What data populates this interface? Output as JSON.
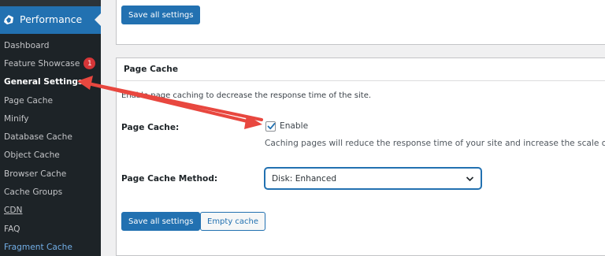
{
  "sidebar": {
    "menu_title": "Performance",
    "items": [
      {
        "label": "Dashboard",
        "badge": ""
      },
      {
        "label": "Feature Showcase",
        "badge": "1"
      },
      {
        "label": "General Settings",
        "badge": ""
      },
      {
        "label": "Page Cache",
        "badge": ""
      },
      {
        "label": "Minify",
        "badge": ""
      },
      {
        "label": "Database Cache",
        "badge": ""
      },
      {
        "label": "Object Cache",
        "badge": ""
      },
      {
        "label": "Browser Cache",
        "badge": ""
      },
      {
        "label": "Cache Groups",
        "badge": ""
      },
      {
        "label": "CDN",
        "badge": ""
      },
      {
        "label": "FAQ",
        "badge": ""
      },
      {
        "label": "Fragment Cache",
        "badge": ""
      }
    ]
  },
  "top_box": {
    "save_label": "Save all settings"
  },
  "page_cache_box": {
    "title": "Page Cache",
    "description": "Enable page caching to decrease the response time of the site.",
    "page_cache_label": "Page Cache:",
    "enable_label": "Enable",
    "enable_checked": true,
    "help_text": "Caching pages will reduce the response time of your site and increase the scale of y",
    "method_label": "Page Cache Method:",
    "method_value": "Disk: Enhanced",
    "save_label": "Save all settings",
    "empty_label": "Empty cache"
  },
  "colors": {
    "sidebar_bg": "#1d2327",
    "accent": "#2271b1",
    "badge": "#d63638",
    "arrow": "#e8473f"
  }
}
